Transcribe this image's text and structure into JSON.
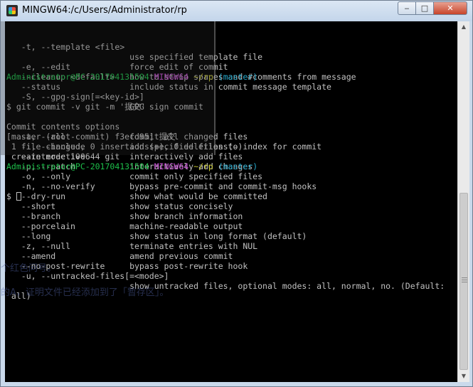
{
  "window": {
    "title": "MINGW64:/c/Users/Administrator/rp",
    "min_glyph": "‒",
    "max_glyph": "□",
    "close_glyph": "✕"
  },
  "background_text": {
    "line1": "个红色问号。",
    "line2": "的A，证明文件已经添加到了「暂存区」。"
  },
  "terminal": {
    "help_lines": [
      "   -t, --template <file>",
      "                         use specified template file",
      "   -e, --edit            force edit of commit",
      "   --cleanup <default>   how to strip spaces and #comments from message",
      "   --status              include status in commit message template",
      "   -S, --gpg-sign[=<key-id>]",
      "                         GPG sign commit",
      "",
      "Commit contents options",
      "   -a, --all             commit all changed files",
      "   -i, --include         add specified files to index for commit",
      "   --interactive         interactively add files",
      "   -p, --patch           interactively add changes",
      "   -o, --only            commit only specified files",
      "   -n, --no-verify       bypass pre-commit and commit-msg hooks",
      "   --dry-run             show what would be committed",
      "   --short               show status concisely",
      "   --branch              show branch information",
      "   --porcelain           machine-readable output",
      "   --long                show status in long format (default)",
      "   -z, --null            terminate entries with NUL",
      "   --amend               amend previous commit",
      "   --no-post-rewrite     bypass post-rewrite hook",
      "   -u, --untracked-files[=<mode>]",
      "                         show untracked files, optional modes: all, normal, no. (Default:",
      " all)",
      ""
    ],
    "prompt1": {
      "user_host": "Administrator@PC-201704131504",
      "shell": "MINGW64",
      "path": "~/rp",
      "branch": "(master)"
    },
    "command": "$ git commit -v git -m '提交'",
    "output_lines": [
      "[master (root-commit) f3efd95] 提交",
      " 1 file changed, 0 insertions(+), 0 deletions(-)",
      " create mode 100644 git",
      ""
    ],
    "prompt2": {
      "user_host": "Administrator@PC-201704131504",
      "shell": "MINGW64",
      "path": "~/rp",
      "branch": "(master)"
    },
    "input_prompt": "$ "
  },
  "scrollbar": {
    "up_glyph": "▲",
    "down_glyph": "▼",
    "position_fraction": 0.53
  },
  "colors": {
    "user_host": "#1dbf4a",
    "shell": "#c94fd6",
    "path": "#c4c42e",
    "branch": "#24a6c9"
  }
}
